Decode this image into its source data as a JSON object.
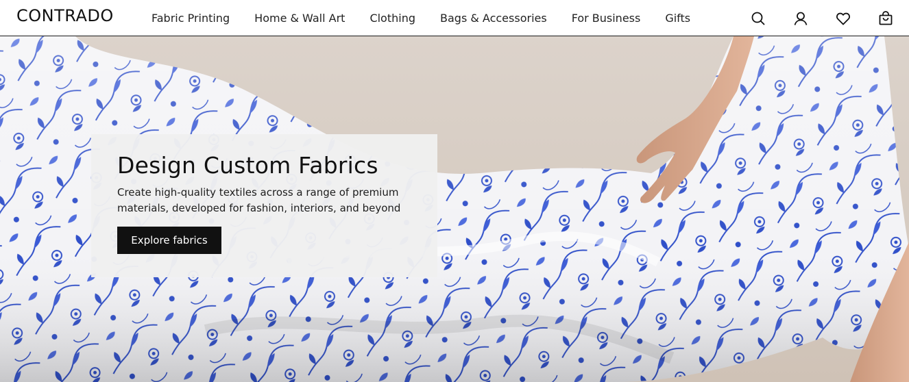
{
  "brand": {
    "name": "CONTRADO"
  },
  "nav": [
    {
      "label": "Fabric Printing"
    },
    {
      "label": "Home & Wall Art"
    },
    {
      "label": "Clothing"
    },
    {
      "label": "Bags & Accessories"
    },
    {
      "label": "For Business"
    },
    {
      "label": "Gifts"
    }
  ],
  "header_icons": [
    "search-icon",
    "account-icon",
    "heart-icon",
    "shopping-bag-icon"
  ],
  "hero": {
    "title": "Design Custom Fabrics",
    "subtitle": "Create high-quality textiles across a range of premium materials, developed for fashion, interiors, and beyond",
    "cta_label": "Explore fabrics"
  },
  "colors": {
    "ink": "#111111",
    "fabric_blue": "#2f4fc9",
    "fabric_white": "#f4f4f6",
    "background": "#d8cec5",
    "card": "#f0f0f0"
  }
}
